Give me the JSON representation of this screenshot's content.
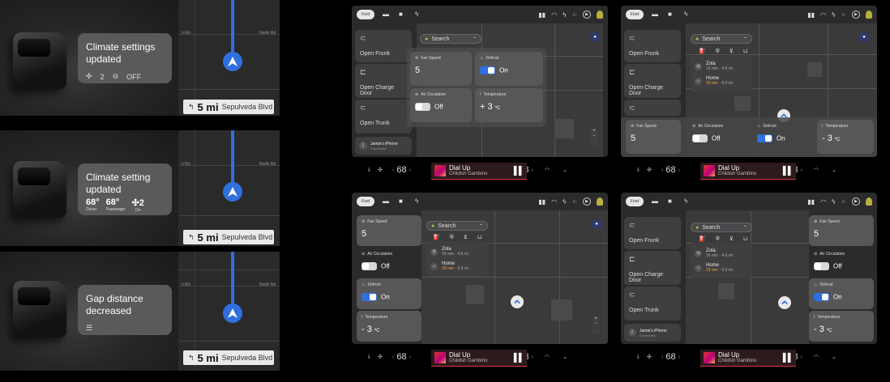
{
  "notifications": [
    {
      "title": "Climate settings updated",
      "fan_value": "2",
      "circ_label": "OFF",
      "turn_distance": "5 mi",
      "turn_road": "Sepulveda Blvd",
      "road_left": "h Rd",
      "road_right": "North Rd"
    },
    {
      "title": "Climate setting updated",
      "driver_temp": "68°",
      "driver_label": "Driver",
      "passenger_temp": "68°",
      "passenger_label": "Passenger",
      "fan_value": "2",
      "fan_label": "On",
      "turn_distance": "5 mi",
      "turn_road": "Sepulveda Blvd",
      "road_left": "h Rd",
      "road_right": "North Rd"
    },
    {
      "title": "Gap distance decreased",
      "turn_distance": "5 mi",
      "turn_road": "Sepulveda Blvd",
      "road_left": "h Rd",
      "road_right": "North Rd"
    }
  ],
  "dashboards": {
    "logo": "Ford",
    "search_label": "Search",
    "open_frunk": "Open Frunk",
    "open_charge_door": "Open Charge Door",
    "open_trunk": "Open Trunk",
    "phone_name": "Jamie's iPhone",
    "phone_status": "Connected",
    "fan_speed_label": "Fan Speed",
    "fan_speed_value": "5",
    "defrost_label": "Defrost",
    "defrost_value": "On",
    "air_circ_label": "Air Circulation",
    "air_circ_value": "Off",
    "temperature_label": "Temperature",
    "temperature_value_a": "+ 3",
    "temperature_value_b": "- 3",
    "temperature_unit": "ºC",
    "dest_1_name": "Zola",
    "dest_1_time": "16 min",
    "dest_1_dist": "· 4.6 mi",
    "dest_2_name": "Home",
    "dest_2_time": "29 min",
    "dest_2_dist": "· 6.9 mi",
    "song": "Dial Up",
    "artist": "Childish Gambino",
    "cabin_temp_left": "68",
    "cabin_temp_right": "68",
    "zoom_plus": "+",
    "zoom_minus": "−"
  },
  "colors": {
    "accent": "#2f6fe0",
    "tile": "#575759",
    "map": "#3a3a3a"
  }
}
